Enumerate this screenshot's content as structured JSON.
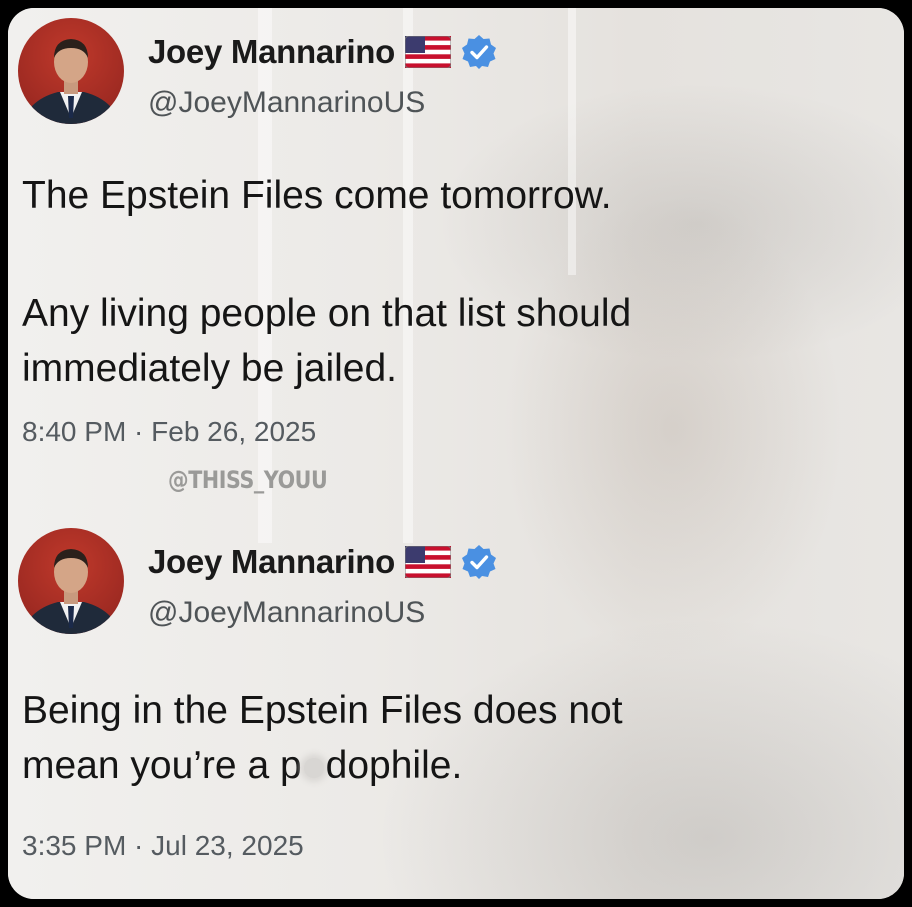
{
  "watermark": "@THISS_YOUU",
  "tweets": [
    {
      "author": {
        "display_name": "Joey Mannarino",
        "handle": "@JoeyMannarinoUS",
        "flag_icon": "us-flag-icon",
        "verified_icon": "verified-badge-icon",
        "verified_color": "#4a90e2"
      },
      "text_lines": [
        "The Epstein Files come tomorrow.",
        "Any living people on that list should",
        "immediately be jailed."
      ],
      "timestamp": "8:40 PM · Feb 26, 2025"
    },
    {
      "author": {
        "display_name": "Joey Mannarino",
        "handle": "@JoeyMannarinoUS",
        "flag_icon": "us-flag-icon",
        "verified_icon": "verified-badge-icon",
        "verified_color": "#4a90e2"
      },
      "text_lines": [
        "Being in the Epstein Files does not",
        "mean you’re a p",
        "dophile."
      ],
      "timestamp": "3:35 PM · Jul 23, 2025"
    }
  ]
}
